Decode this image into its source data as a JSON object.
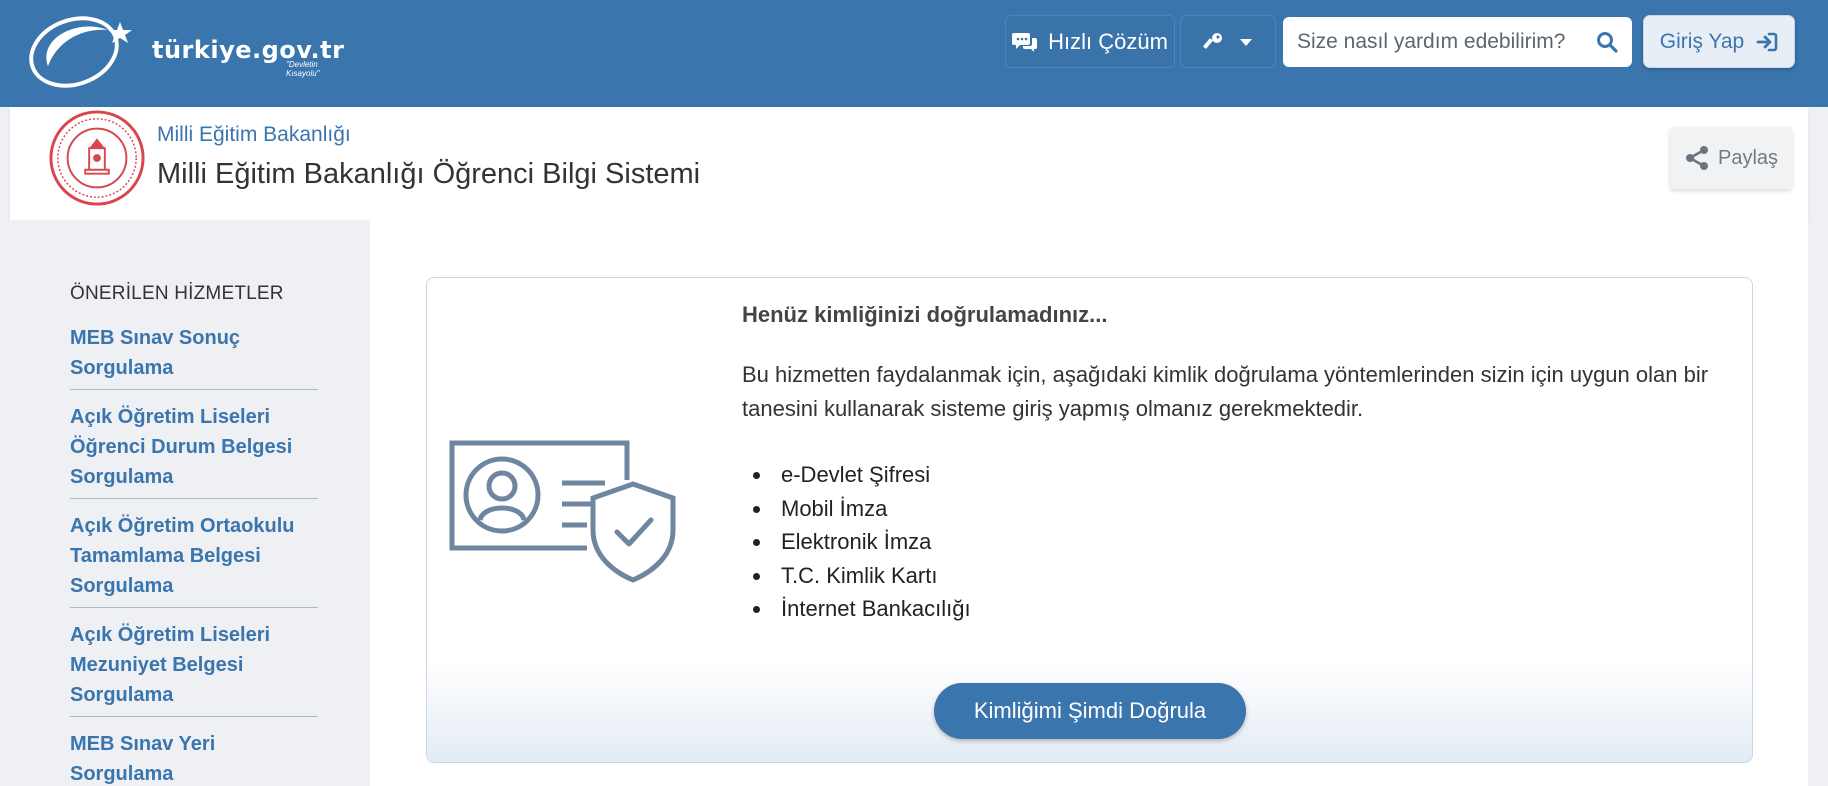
{
  "topbar": {
    "logo_text": "türkiye.gov.tr",
    "logo_tagline": "\"Devletin Kısayolu\"",
    "quick_solution_label": "Hızlı Çözüm",
    "search_placeholder": "Size nasıl yardım edebilirim?",
    "login_label": "Giriş Yap"
  },
  "header": {
    "org_name": "Milli Eğitim Bakanlığı",
    "service_title": "Milli Eğitim Bakanlığı Öğrenci Bilgi Sistemi",
    "share_label": "Paylaş"
  },
  "sidebar": {
    "title": "ÖNERİLEN HİZMETLER",
    "items": [
      {
        "label": "MEB Sınav Sonuç Sorgulama"
      },
      {
        "label": "Açık Öğretim Liseleri Öğrenci Durum Belgesi Sorgulama"
      },
      {
        "label": "Açık Öğretim Ortaokulu Tamamlama Belgesi Sorgulama"
      },
      {
        "label": "Açık Öğretim Liseleri Mezuniyet Belgesi Sorgulama"
      },
      {
        "label": "MEB Sınav Yeri Sorgulama"
      }
    ]
  },
  "verify": {
    "heading": "Henüz kimliğinizi doğrulamadınız...",
    "description": "Bu hizmetten faydalanmak için, aşağıdaki kimlik doğrulama yöntemlerinden sizin için uygun olan bir tanesini kullanarak sisteme giriş yapmış olmanız gerekmektedir.",
    "methods": [
      "e-Devlet Şifresi",
      "Mobil İmza",
      "Elektronik İmza",
      "T.C. Kimlik Kartı",
      "İnternet Bankacılığı"
    ],
    "button_label": "Kimliğimi Şimdi Doğrula"
  },
  "colors": {
    "brand_blue": "#3b75ae",
    "sidebar_bg": "#eef0f3",
    "seal_red": "#d9464b",
    "illustration_gray": "#6f86a0"
  },
  "icons": {
    "logo": "crescent-star-logo",
    "quick": "chat-bubbles-icon",
    "key": "key-icon",
    "dropdown": "caret-down-icon",
    "search": "search-icon",
    "login": "sign-in-icon",
    "share": "share-icon",
    "illustration": "id-card-shield-icon"
  }
}
